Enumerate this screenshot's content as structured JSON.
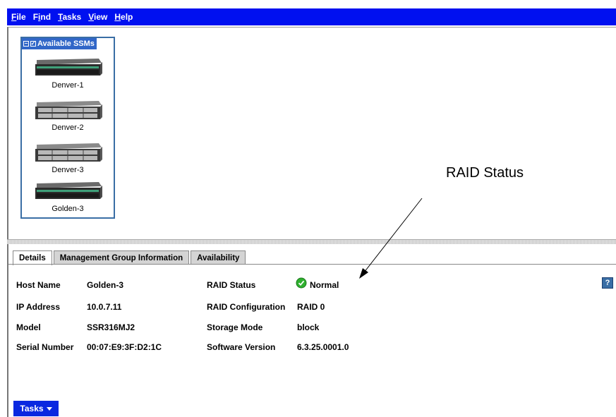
{
  "menu": [
    {
      "ul": "F",
      "rest": "ile"
    },
    {
      "ul": "F",
      "rest": "ind",
      "pre": "",
      "split": "i",
      "full": "Find"
    },
    {
      "ul": "T",
      "rest": "asks"
    },
    {
      "ul": "V",
      "rest": "iew"
    },
    {
      "ul": "H",
      "rest": "elp"
    }
  ],
  "ssm_panel": {
    "title": "Available SSMs",
    "items": [
      {
        "label": "Denver-1"
      },
      {
        "label": "Denver-2"
      },
      {
        "label": "Denver-3"
      },
      {
        "label": "Golden-3"
      }
    ]
  },
  "tabs": [
    {
      "label": "Details"
    },
    {
      "label": "Management Group Information"
    },
    {
      "label": "Availability"
    }
  ],
  "details": {
    "host_name_label": "Host Name",
    "host_name": "Golden-3",
    "ip_label": "IP Address",
    "ip": "10.0.7.11",
    "model_label": "Model",
    "model": "SSR316MJ2",
    "serial_label": "Serial Number",
    "serial": "00:07:E9:3F:D2:1C",
    "raid_status_label": "RAID Status",
    "raid_status": "Normal",
    "raid_config_label": "RAID Configuration",
    "raid_config": "RAID 0",
    "storage_mode_label": "Storage Mode",
    "storage_mode": "block",
    "software_label": "Software Version",
    "software": "6.3.25.0001.0"
  },
  "help_label": "?",
  "tasks_button": "Tasks",
  "annotation": "RAID Status",
  "icons": {
    "status": "check-circle-icon",
    "drive": "storage-module-icon"
  },
  "colors": {
    "menubar": "#0010f0",
    "panel_header": "#3167c8",
    "tasks_button": "#0a28e0",
    "status_ok": "#2fb02f"
  }
}
